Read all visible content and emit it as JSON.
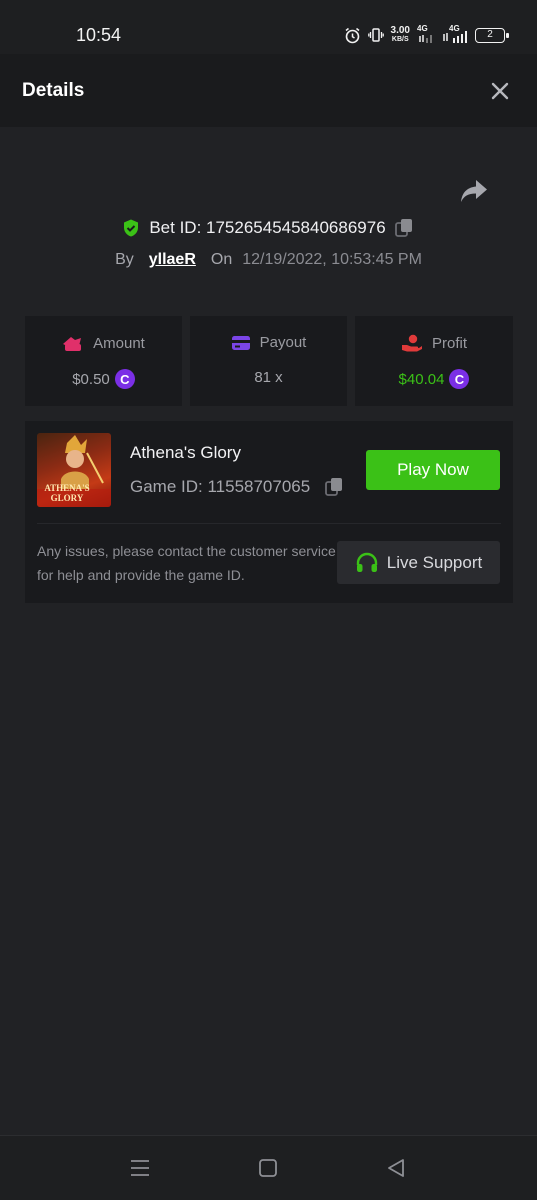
{
  "status_bar": {
    "time": "10:54",
    "speed_value": "3.00",
    "speed_unit": "KB/S",
    "net1": "4G",
    "net2": "4G",
    "battery": "2",
    "icons": [
      "alarm-icon",
      "vibrate-icon",
      "signal-icon",
      "battery-icon"
    ]
  },
  "header": {
    "title": "Details",
    "close_icon": "close-icon"
  },
  "bet": {
    "id_label": "Bet ID: 1752654545840686976",
    "by_label": "By",
    "username": "yllaeR",
    "on_label": "On",
    "datetime": "12/19/2022, 10:53:45 PM"
  },
  "stats": {
    "amount": {
      "label": "Amount",
      "value": "$0.50",
      "coin": "C"
    },
    "payout": {
      "label": "Payout",
      "value": "81 x"
    },
    "profit": {
      "label": "Profit",
      "value": "$40.04",
      "coin": "C"
    }
  },
  "game": {
    "name": "Athena's Glory",
    "id_label": "Game ID: 11558707065",
    "thumb_text": "ATHENA'S GLORY",
    "play_label": "Play Now",
    "issue_text": "Any issues, please contact the customer service for help and provide the game ID.",
    "support_label": "Live Support"
  },
  "colors": {
    "accent_green": "#3bc117",
    "shield_green": "#3bc117",
    "profit_green": "#3bc117",
    "coin_purple": "#7b2fe6",
    "amount_pink": "#e0306a",
    "payout_purple": "#7b45e8",
    "profit_red": "#e03a3a"
  }
}
